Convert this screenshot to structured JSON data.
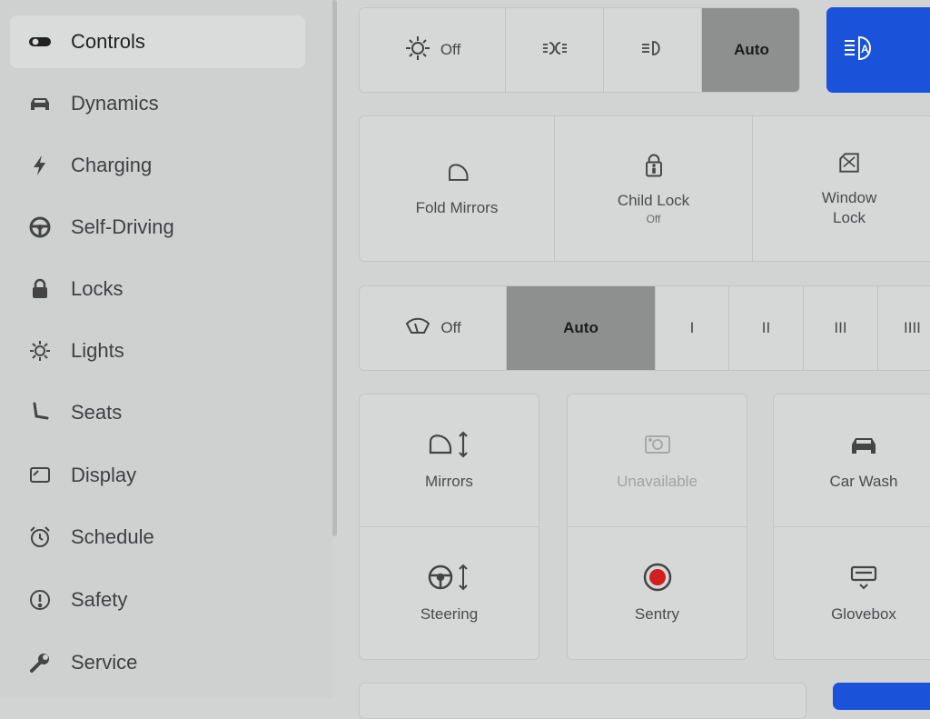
{
  "sidebar": {
    "items": [
      {
        "label": "Controls",
        "icon": "toggle-icon"
      },
      {
        "label": "Dynamics",
        "icon": "car-icon"
      },
      {
        "label": "Charging",
        "icon": "bolt-icon"
      },
      {
        "label": "Self-Driving",
        "icon": "steering-wheel-icon"
      },
      {
        "label": "Locks",
        "icon": "lock-icon"
      },
      {
        "label": "Lights",
        "icon": "sun-icon"
      },
      {
        "label": "Seats",
        "icon": "seat-icon"
      },
      {
        "label": "Display",
        "icon": "display-icon"
      },
      {
        "label": "Schedule",
        "icon": "alarm-clock-icon"
      },
      {
        "label": "Safety",
        "icon": "alert-circle-icon"
      },
      {
        "label": "Service",
        "icon": "wrench-icon"
      }
    ],
    "active": "Controls"
  },
  "lights": {
    "off_label": "Off",
    "auto_label": "Auto",
    "selected": "Auto",
    "accent_color": "#1a52d9"
  },
  "locks": {
    "fold_mirrors": "Fold Mirrors",
    "child_lock": "Child Lock",
    "child_lock_status": "Off",
    "window_lock_line1": "Window",
    "window_lock_line2": "Lock"
  },
  "wipers": {
    "off_label": "Off",
    "auto_label": "Auto",
    "speeds": [
      "I",
      "II",
      "III",
      "IIII"
    ],
    "selected": "Auto"
  },
  "tiles": {
    "mirrors": "Mirrors",
    "unavailable": "Unavailable",
    "car_wash": "Car Wash",
    "steering": "Steering",
    "sentry": "Sentry",
    "glovebox": "Glovebox",
    "sentry_color": "#d11f1f"
  }
}
